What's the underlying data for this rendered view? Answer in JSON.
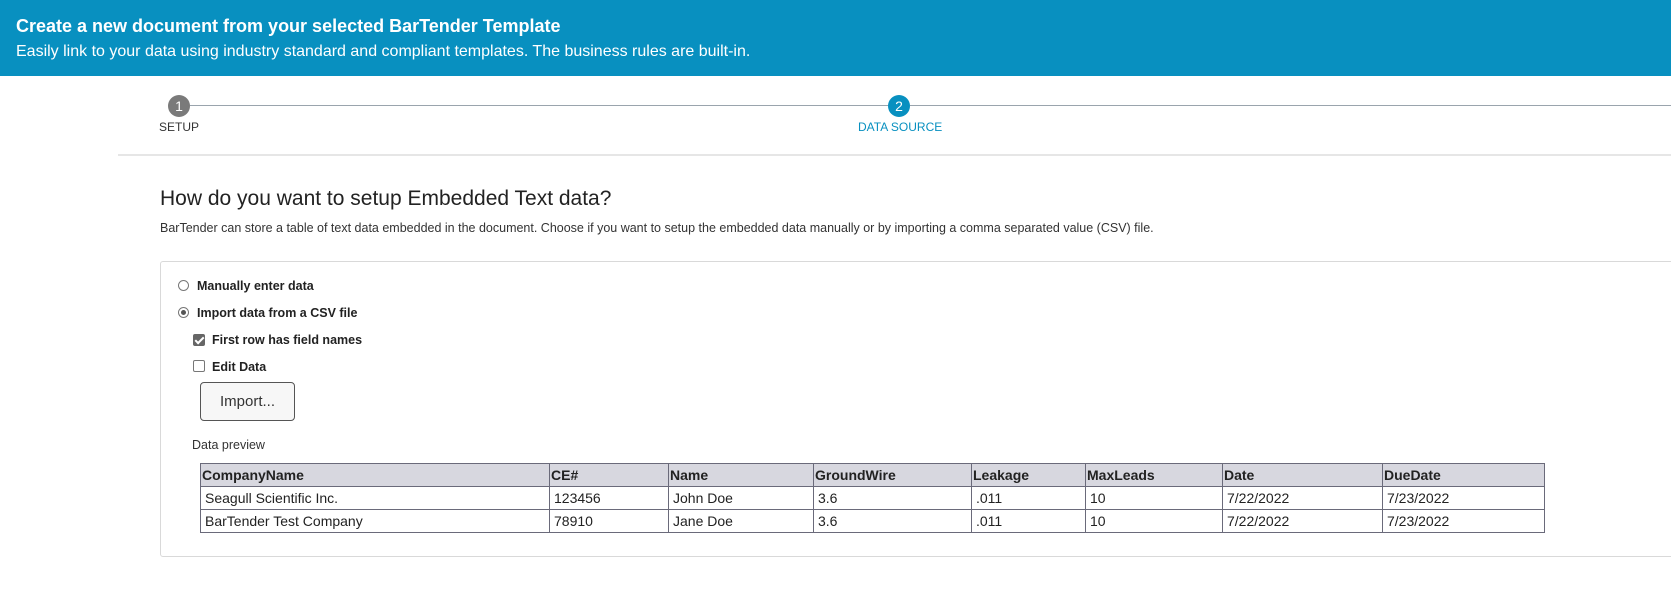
{
  "banner": {
    "title": "Create a new document from your selected BarTender Template",
    "subtitle": "Easily link to your data using industry standard and compliant templates. The business rules are built-in."
  },
  "stepper": {
    "steps": [
      {
        "number": "1",
        "label": "SETUP",
        "state": "completed",
        "color": "#7a7a7a"
      },
      {
        "number": "2",
        "label": "DATA SOURCE",
        "state": "active",
        "color": "#0890c0"
      }
    ]
  },
  "section": {
    "heading": "How do you want to setup Embedded Text data?",
    "description": "BarTender can store a table of text data embedded in the document. Choose if you want to setup the embedded data manually or by importing a comma separated value (CSV) file."
  },
  "options": {
    "manual_label": "Manually enter data",
    "manual_selected": false,
    "csv_label": "Import data from a CSV file",
    "csv_selected": true,
    "first_row_label": "First row has field names",
    "first_row_checked": true,
    "edit_data_label": "Edit Data",
    "edit_data_checked": false,
    "import_button_label": "Import..."
  },
  "preview": {
    "label": "Data preview",
    "columns": [
      "CompanyName",
      "CE#",
      "Name",
      "GroundWire",
      "Leakage",
      "MaxLeads",
      "Date",
      "DueDate"
    ],
    "rows": [
      [
        "Seagull Scientific Inc.",
        "123456",
        "John Doe",
        "3.6",
        ".011",
        "10",
        "7/22/2022",
        "7/23/2022"
      ],
      [
        "BarTender Test Company",
        "78910",
        "Jane Doe",
        "3.6",
        ".011",
        "10",
        "7/22/2022",
        "7/23/2022"
      ]
    ]
  },
  "colors": {
    "banner": "#0890c0",
    "accent": "#0890c0",
    "table_header": "#d7d7df"
  }
}
